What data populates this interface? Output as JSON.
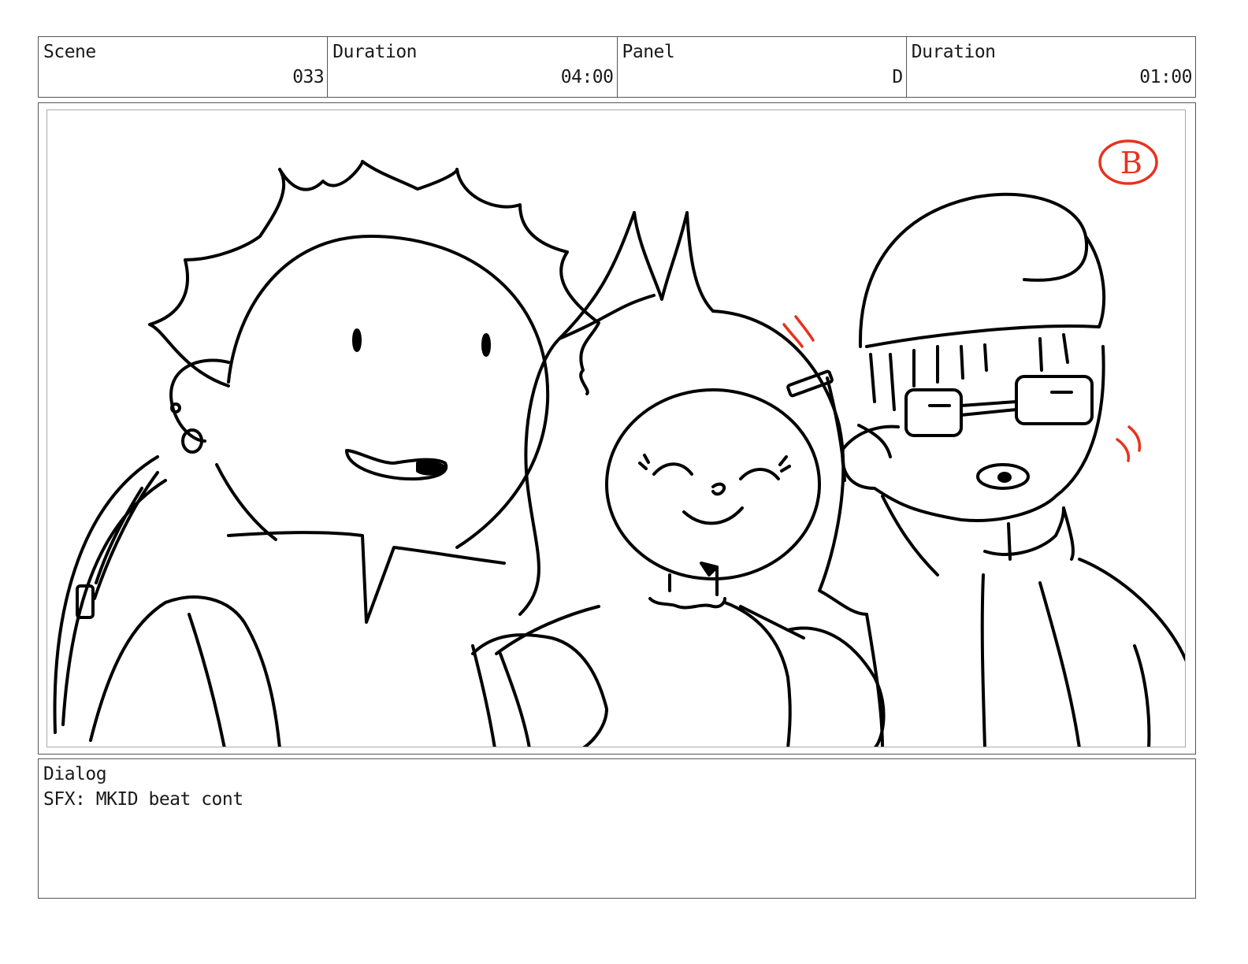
{
  "header": {
    "scene_label": "Scene",
    "scene_value": "033",
    "scene_duration_label": "Duration",
    "scene_duration_value": "04:00",
    "panel_label": "Panel",
    "panel_value": "D",
    "panel_duration_label": "Duration",
    "panel_duration_value": "01:00"
  },
  "frame": {
    "panel_mark": "B",
    "ink_color": "#000000",
    "annotation_color": "#e8321c"
  },
  "dialog": {
    "label": "Dialog",
    "text": "SFX: MKID beat cont"
  }
}
